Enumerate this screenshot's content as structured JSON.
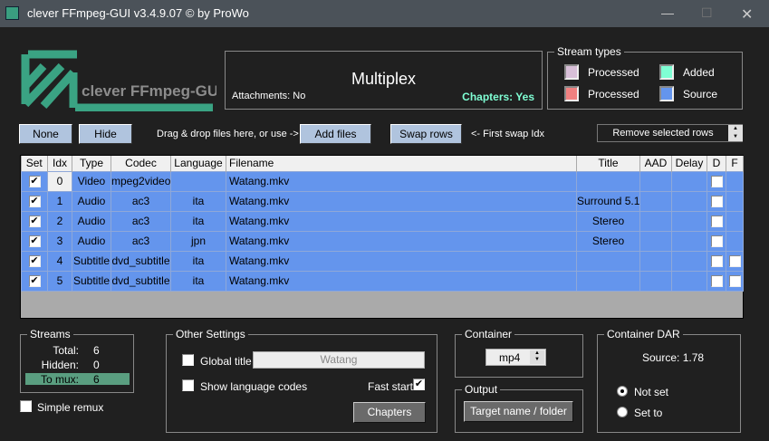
{
  "window": {
    "title": "clever FFmpeg-GUI v3.4.9.07   © by ProWo"
  },
  "logo": {
    "text": "clever FFmpeg-GUI"
  },
  "header": {
    "mode": "Multiplex",
    "attachments": "Attachments: No",
    "chapters": "Chapters: Yes"
  },
  "stream_types": {
    "legend": "Stream types",
    "items": [
      {
        "label": "Processed",
        "color": "#d8bfd8"
      },
      {
        "label": "Added",
        "color": "#7fffd4"
      },
      {
        "label": "Processed",
        "color": "#f08080"
      },
      {
        "label": "Source",
        "color": "#6495ed"
      }
    ]
  },
  "toolbar": {
    "none": "None",
    "hide": "Hide",
    "drag_hint": "Drag & drop files here, or use ->",
    "add_files": "Add files",
    "swap_rows": "Swap rows",
    "swap_hint": "<- First swap Idx",
    "remove_rows": "Remove selected rows"
  },
  "table": {
    "columns": [
      "Set",
      "Idx",
      "Type",
      "Codec",
      "Language",
      "Filename",
      "Title",
      "AAD",
      "Delay",
      "D",
      "F"
    ],
    "rows": [
      {
        "set": true,
        "idx": "0",
        "type": "Video",
        "codec": "mpeg2video",
        "lang": "",
        "file": "Watang.mkv",
        "title": "",
        "aad": "",
        "delay": "",
        "d": false,
        "f": null
      },
      {
        "set": true,
        "idx": "1",
        "type": "Audio",
        "codec": "ac3",
        "lang": "ita",
        "file": "Watang.mkv",
        "title": "Surround 5.1",
        "aad": "",
        "delay": "",
        "d": false,
        "f": null
      },
      {
        "set": true,
        "idx": "2",
        "type": "Audio",
        "codec": "ac3",
        "lang": "ita",
        "file": "Watang.mkv",
        "title": "Stereo",
        "aad": "",
        "delay": "",
        "d": false,
        "f": null
      },
      {
        "set": true,
        "idx": "3",
        "type": "Audio",
        "codec": "ac3",
        "lang": "jpn",
        "file": "Watang.mkv",
        "title": "Stereo",
        "aad": "",
        "delay": "",
        "d": false,
        "f": null
      },
      {
        "set": true,
        "idx": "4",
        "type": "Subtitle",
        "codec": "dvd_subtitle",
        "lang": "ita",
        "file": "Watang.mkv",
        "title": "",
        "aad": "",
        "delay": "",
        "d": false,
        "f": false
      },
      {
        "set": true,
        "idx": "5",
        "type": "Subtitle",
        "codec": "dvd_subtitle",
        "lang": "ita",
        "file": "Watang.mkv",
        "title": "",
        "aad": "",
        "delay": "",
        "d": false,
        "f": false
      }
    ]
  },
  "streams": {
    "legend": "Streams",
    "total_label": "Total:",
    "total": "6",
    "hidden_label": "Hidden:",
    "hidden": "0",
    "tomux_label": "To mux:",
    "tomux": "6"
  },
  "simple_remux": {
    "label": "Simple remux",
    "checked": false
  },
  "other": {
    "legend": "Other Settings",
    "global_title_label": "Global title",
    "global_title_value": "Watang",
    "show_lang": "Show language codes",
    "fast_start": "Fast start",
    "fast_start_checked": true,
    "chapters": "Chapters"
  },
  "container": {
    "legend": "Container",
    "value": "mp4"
  },
  "output": {
    "legend": "Output",
    "button": "Target name / folder"
  },
  "dar": {
    "legend": "Container DAR",
    "source": "Source: 1.78",
    "not_set": "Not set",
    "set_to": "Set to",
    "selected": "Not set"
  }
}
